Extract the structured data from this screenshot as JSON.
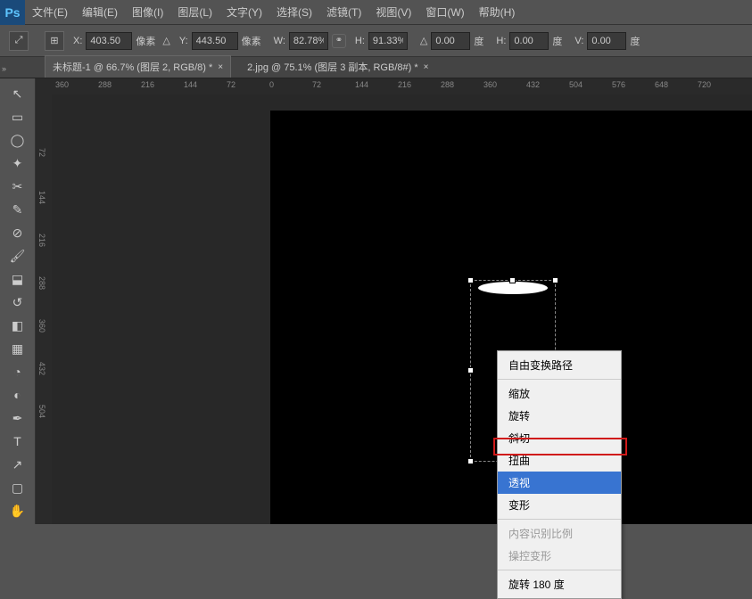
{
  "app_logo": "Ps",
  "menu": [
    "文件(E)",
    "编辑(E)",
    "图像(I)",
    "图层(L)",
    "文字(Y)",
    "选择(S)",
    "滤镜(T)",
    "视图(V)",
    "窗口(W)",
    "帮助(H)"
  ],
  "options": {
    "x_label": "X:",
    "x_val": "403.50",
    "x_unit": "像素",
    "y_label": "Y:",
    "y_val": "443.50",
    "y_unit": "像素",
    "w_label": "W:",
    "w_val": "82.78%",
    "h_label": "H:",
    "h_val": "91.33%",
    "r_val": "0.00",
    "r_unit": "度",
    "hskew_label": "H:",
    "hskew_val": "0.00",
    "hskew_unit": "度",
    "vskew_label": "V:",
    "vskew_val": "0.00",
    "vskew_unit": "度"
  },
  "tabs": [
    {
      "label": "未标题-1 @ 66.7% (图层 2, RGB/8) *"
    },
    {
      "label": "2.jpg @ 75.1% (图层 3 副本, RGB/8#) *"
    }
  ],
  "ruler_h": [
    "360",
    "288",
    "216",
    "144",
    "72",
    "0",
    "72",
    "144",
    "216",
    "288",
    "360",
    "432",
    "504",
    "576",
    "648",
    "720"
  ],
  "ruler_v": [
    "72",
    "144",
    "216",
    "288",
    "360",
    "432",
    "504"
  ],
  "context": {
    "free": "自由变换路径",
    "scale": "缩放",
    "rotate": "旋转",
    "skew": "斜切",
    "distort": "扭曲",
    "perspective": "透视",
    "warp": "变形",
    "content_aware": "内容识别比例",
    "puppet": "操控变形",
    "rot180": "旋转 180 度"
  }
}
